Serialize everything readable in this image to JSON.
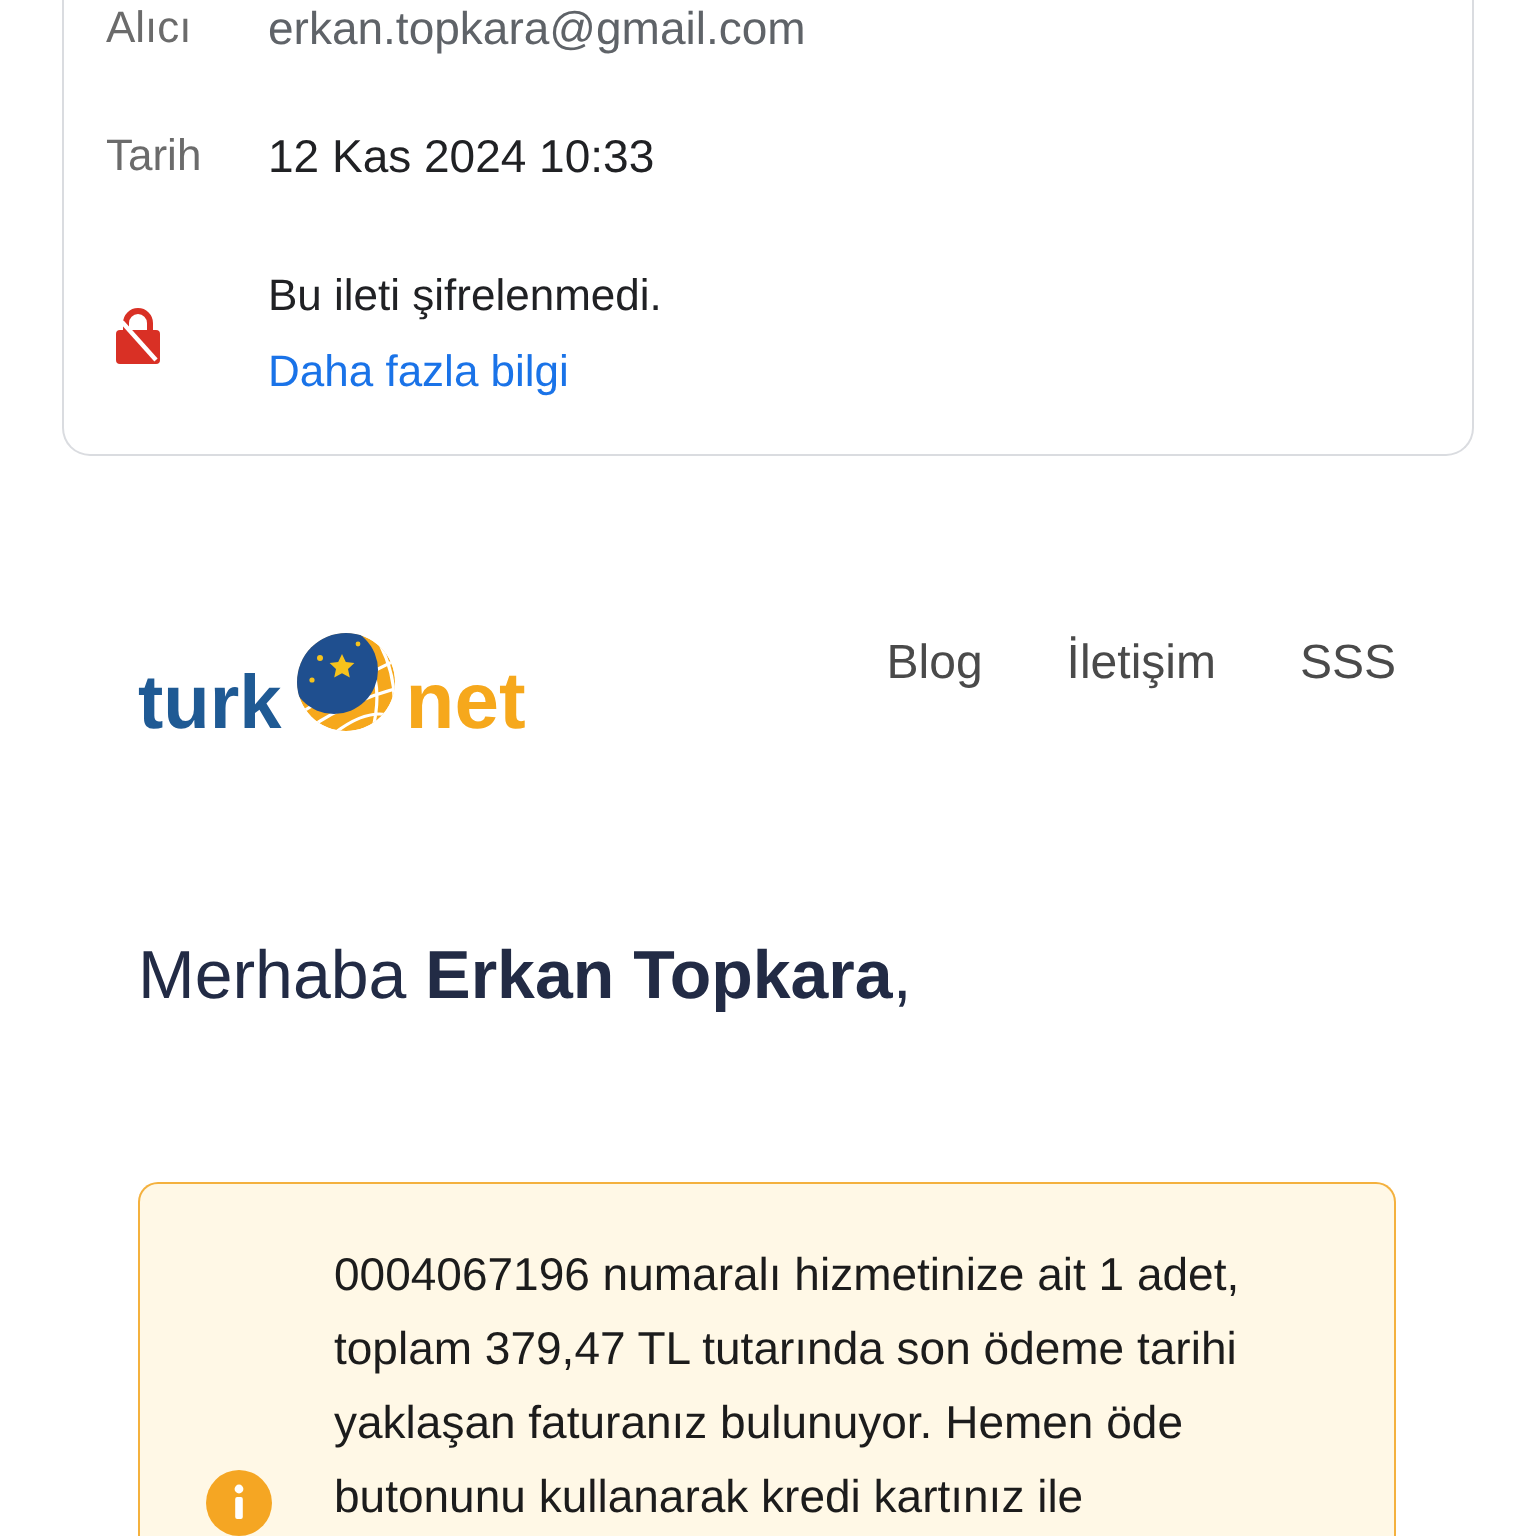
{
  "message_details": {
    "rows": [
      {
        "label": "Alıcı",
        "value": "erkan.topkara@gmail.com",
        "kind": "email"
      },
      {
        "label": "Tarih",
        "value": "12 Kas 2024 10:33",
        "kind": "date"
      }
    ],
    "encryption": {
      "encrypted": false,
      "text": "Bu ileti şifrelenmedi.",
      "link": "Daha fazla bilgi"
    }
  },
  "email_body": {
    "logo": {
      "word_1": "turk",
      "word_2": "net"
    },
    "nav_links": [
      "Blog",
      "İletişim",
      "SSS"
    ],
    "greeting": "Merhaba **Erkan Topkara**,",
    "notice": {
      "kind": "warning",
      "text": "0004067196 numaralı hizmetinize ait 1 adet, toplam 379,47 TL tutarında son ödeme tarihi yaklaşan faturanız bulunuyor. Hemen öde butonunu kullanarak kredi kartınız ile"
    }
  }
}
